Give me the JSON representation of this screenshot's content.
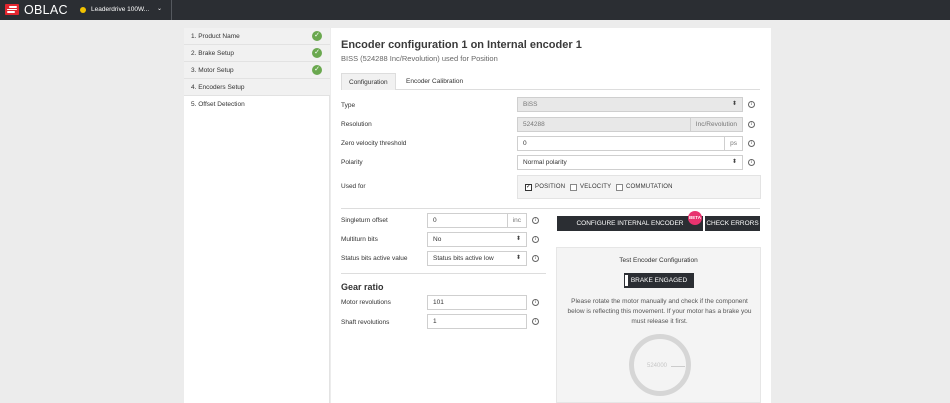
{
  "header": {
    "logo_text": "OBLAC",
    "device_name": "Leaderdrive 100W...",
    "device_status_color": "#f2c200"
  },
  "sidebar": {
    "steps": [
      {
        "label": "1. Product Name",
        "done": true
      },
      {
        "label": "2. Brake Setup",
        "done": true
      },
      {
        "label": "3. Motor Setup",
        "done": true
      },
      {
        "label": "4. Encoders Setup",
        "done": false,
        "active": true
      },
      {
        "label": "5. Offset Detection",
        "done": false
      }
    ],
    "check_glyph": "✓"
  },
  "main": {
    "title": "Encoder configuration 1 on Internal encoder 1",
    "subtitle": "BISS (524288 Inc/Revolution) used for Position",
    "tabs": [
      "Configuration",
      "Encoder Calibration"
    ],
    "fields": {
      "type": {
        "label": "Type",
        "value": "BiSS"
      },
      "resolution": {
        "label": "Resolution",
        "value": "524288",
        "unit": "Inc/Revolution"
      },
      "zero_velocity": {
        "label": "Zero velocity threshold",
        "value": "0",
        "unit": "ps"
      },
      "polarity": {
        "label": "Polarity",
        "value": "Normal polarity"
      },
      "used_for": {
        "label": "Used for",
        "options": [
          {
            "label": "POSITION",
            "checked": true
          },
          {
            "label": "VELOCITY",
            "checked": false
          },
          {
            "label": "COMMUTATION",
            "checked": false
          }
        ]
      },
      "singleturn_offset": {
        "label": "Singleturn offset",
        "value": "0",
        "unit": "inc"
      },
      "multiturn_bits": {
        "label": "Multiturn bits",
        "value": "No"
      },
      "status_bits": {
        "label": "Status bits active value",
        "value": "Status bits active low"
      }
    },
    "gear_ratio": {
      "title": "Gear ratio",
      "motor_revolutions": {
        "label": "Motor revolutions",
        "value": "101"
      },
      "shaft_revolutions": {
        "label": "Shaft revolutions",
        "value": "1"
      }
    },
    "buttons": {
      "configure": "CONFIGURE INTERNAL ENCODER",
      "check_errors": "CHECK ERRORS",
      "badge": "BETA"
    },
    "test": {
      "title": "Test Encoder Configuration",
      "brake_button": "BRAKE ENGAGED",
      "description": "Please rotate the motor manually and check if the component below is reflecting this movement. If your motor has a brake you must release it first.",
      "gauge_value": "524000"
    },
    "icons": {
      "info": "i",
      "select_arrow": "⬍",
      "checkmark": "✓",
      "chevron_down": "⌄"
    }
  }
}
